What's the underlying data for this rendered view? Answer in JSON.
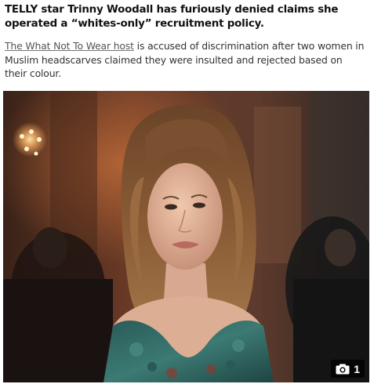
{
  "article": {
    "headline": "TELLY star Trinny Woodall has furiously denied claims she operated a “whites-only” recruitment policy.",
    "lede_link": "The What Not To Wear host",
    "lede_rest": " is accused of discrimination after two women in Muslim headscarves claimed they were insulted and rejected based on their colour."
  },
  "photo": {
    "gallery_count": "1",
    "badge_icon": "camera-icon"
  },
  "colors": {
    "headline": "#111111",
    "body_text": "#333333",
    "link": "#555555",
    "badge_bg": "#000000"
  }
}
